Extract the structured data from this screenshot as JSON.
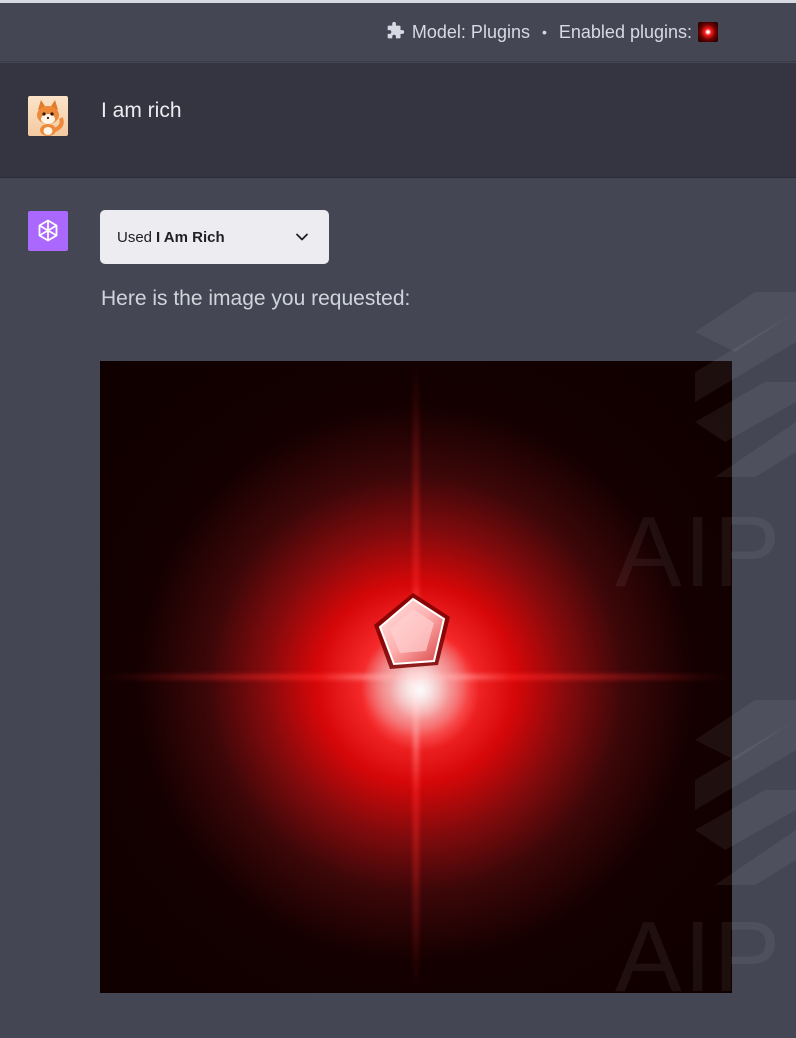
{
  "header": {
    "model_label": "Model: Plugins",
    "separator": "•",
    "enabled_label": "Enabled plugins:",
    "icons": {
      "puzzle": "puzzle-icon",
      "plugin": "i-am-rich-plugin-icon"
    }
  },
  "conversation": {
    "user_message": {
      "text": "I am rich",
      "avatar": "fox-avatar"
    },
    "assistant_message": {
      "avatar": "openai-logo-icon",
      "plugin_pill": {
        "prefix": "Used",
        "plugin_name": "I Am Rich"
      },
      "text": "Here is the image you requested:",
      "image": "red-gem-image"
    }
  },
  "watermark": {
    "text_top": "AIP",
    "text_bottom": "AIP"
  },
  "colors": {
    "page_bg": "#444654",
    "user_row_bg": "#343541",
    "pill_bg": "#ececf1",
    "bot_avatar_bg": "#ab68ff",
    "gem_red": "#ff2020"
  }
}
